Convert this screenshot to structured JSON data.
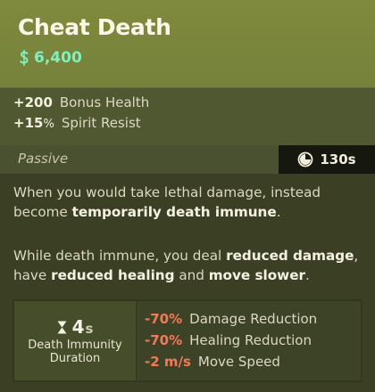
{
  "item": {
    "title": "Cheat Death",
    "cost": "6,400"
  },
  "stats": [
    {
      "value": "+200",
      "unit": "",
      "label": "Bonus Health"
    },
    {
      "value": "+15",
      "unit": "%",
      "label": "Spirit Resist"
    }
  ],
  "passive": {
    "label": "Passive",
    "cooldown": "130s"
  },
  "description": {
    "p1_a": "When you would take lethal damage, instead become ",
    "p1_b": "temporarily death immune",
    "p1_c": ".",
    "p2_a": "While death immune, you deal ",
    "p2_b": "reduced damage",
    "p2_c": ", have ",
    "p2_d": "reduced healing",
    "p2_e": " and ",
    "p2_f": "move slower",
    "p2_g": "."
  },
  "immunity": {
    "value": "4",
    "unit": "s",
    "label_line1": "Death Immunity",
    "label_line2": "Duration"
  },
  "effects": [
    {
      "value": "-70%",
      "label": "Damage Reduction"
    },
    {
      "value": "-70%",
      "label": "Healing Reduction"
    },
    {
      "value": "-2 m/s",
      "label": "Move Speed"
    }
  ],
  "colors": {
    "header": "#7f8a3e",
    "cost": "#7ff0c0",
    "negative": "#f07a5a",
    "badge_bg": "#16170f"
  },
  "icons": {
    "cost": "souls-icon",
    "cooldown": "cooldown-timer-icon",
    "duration": "hourglass-icon"
  }
}
